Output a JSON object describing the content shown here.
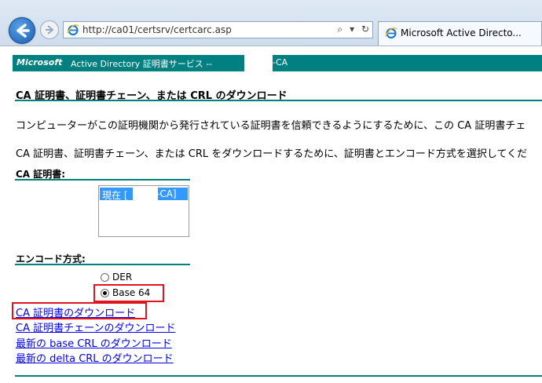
{
  "browser": {
    "url": "http://ca01/certsrv/certcarc.asp",
    "address_controls": [
      "⌕",
      "▾",
      "↻"
    ],
    "tab_title": "Microsoft Active Directo...",
    "icons": [
      "back-arrow-icon",
      "forward-arrow-icon",
      "ie-logo-icon",
      "search-icon",
      "refresh-icon"
    ]
  },
  "header": {
    "microsoft": "Microsoft",
    "service": "Active Directory 証明書サービス  --",
    "ca_suffix": "-CA"
  },
  "page": {
    "title": "CA 証明書、証明書チェーン、または CRL のダウンロード",
    "para1": "コンピューターがこの証明機関から発行されている証明書を信頼できるようにするために、この CA 証明書チェ",
    "para2": "CA 証明書、証明書チェーン、または CRL をダウンロードするために、証明書とエンコード方式を選択してくだ"
  },
  "ca_cert": {
    "label": "CA 証明書:",
    "selected_prefix": "現在 [",
    "selected_suffix": "-CA]"
  },
  "encoding": {
    "label": "エンコード方式:",
    "options": [
      {
        "label": "DER",
        "checked": false
      },
      {
        "label": "Base 64",
        "checked": true
      }
    ]
  },
  "links": {
    "download_ca_cert": "CA 証明書のダウンロード",
    "download_chain": "CA 証明書チェーンのダウンロード",
    "download_base_crl": "最新の base CRL のダウンロード",
    "download_delta_crl": "最新の delta CRL のダウンロード"
  },
  "colors": {
    "accent": "#008080",
    "highlight_box": "#e0141e",
    "link": "#0000ee",
    "selection": "#3399ff"
  }
}
